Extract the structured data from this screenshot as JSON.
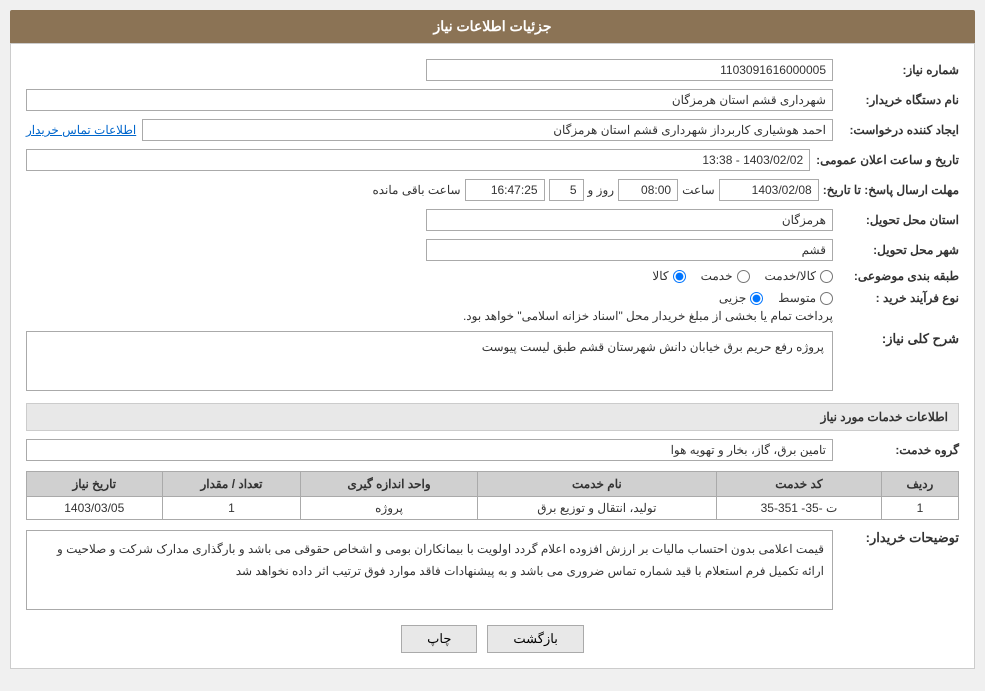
{
  "header": {
    "title": "جزئیات اطلاعات نیاز"
  },
  "form": {
    "need_number_label": "شماره نیاز:",
    "need_number_value": "1103091616000005",
    "buyer_org_label": "نام دستگاه خریدار:",
    "buyer_org_value": "شهرداری قشم استان هرمزگان",
    "requester_label": "ایجاد کننده درخواست:",
    "requester_value": "احمد هوشیاری کاربرداز شهرداری قشم استان هرمزگان",
    "contact_link": "اطلاعات تماس خریدار",
    "announce_date_label": "تاریخ و ساعت اعلان عمومی:",
    "announce_date_value": "1403/02/02 - 13:38",
    "deadline_label": "مهلت ارسال پاسخ: تا تاریخ:",
    "deadline_date": "1403/02/08",
    "deadline_time_label": "ساعت",
    "deadline_time": "08:00",
    "deadline_days_label": "روز و",
    "deadline_days": "5",
    "deadline_remain_label": "ساعت باقی مانده",
    "deadline_remain": "16:47:25",
    "province_label": "استان محل تحویل:",
    "province_value": "هرمزگان",
    "city_label": "شهر محل تحویل:",
    "city_value": "قشم",
    "category_label": "طبقه بندی موضوعی:",
    "category_options": [
      "کالا",
      "خدمت",
      "کالا/خدمت"
    ],
    "category_selected": "کالا",
    "purchase_type_label": "نوع فرآیند خرید :",
    "purchase_type_options": [
      "جزیی",
      "متوسط"
    ],
    "purchase_type_note": "پرداخت تمام یا بخشی از مبلغ خریدار محل \"اسناد خزانه اسلامی\" خواهد بود.",
    "need_desc_label": "شرح کلی نیاز:",
    "need_desc_value": "پروژه رفع حریم برق خیابان دانش شهرستان قشم طبق لیست پیوست",
    "services_section_title": "اطلاعات خدمات مورد نیاز",
    "service_group_label": "گروه خدمت:",
    "service_group_value": "تامین برق، گاز، بخار و تهویه هوا",
    "table": {
      "columns": [
        "ردیف",
        "کد خدمت",
        "نام خدمت",
        "واحد اندازه گیری",
        "تعداد / مقدار",
        "تاریخ نیاز"
      ],
      "rows": [
        {
          "row_num": "1",
          "service_code": "ت -35- 351-35",
          "service_name": "تولید، انتقال و توزیع برق",
          "unit": "پروژه",
          "quantity": "1",
          "need_date": "1403/03/05"
        }
      ]
    },
    "buyer_notes_label": "توضیحات خریدار:",
    "buyer_notes_value": "قیمت اعلامی بدون احتساب مالیات بر ارزش افزوده اعلام گردد اولویت با بیمانکاران بومی و اشخاص حقوقی می باشد و بارگذاری مدارک شرکت و صلاحیت و ارائه تکمیل فرم استعلام با قید شماره تماس ضروری می باشد و به پیشنهادات فاقد موارد فوق ترتیب اثر داده نخواهد شد",
    "btn_print": "چاپ",
    "btn_back": "بازگشت"
  }
}
